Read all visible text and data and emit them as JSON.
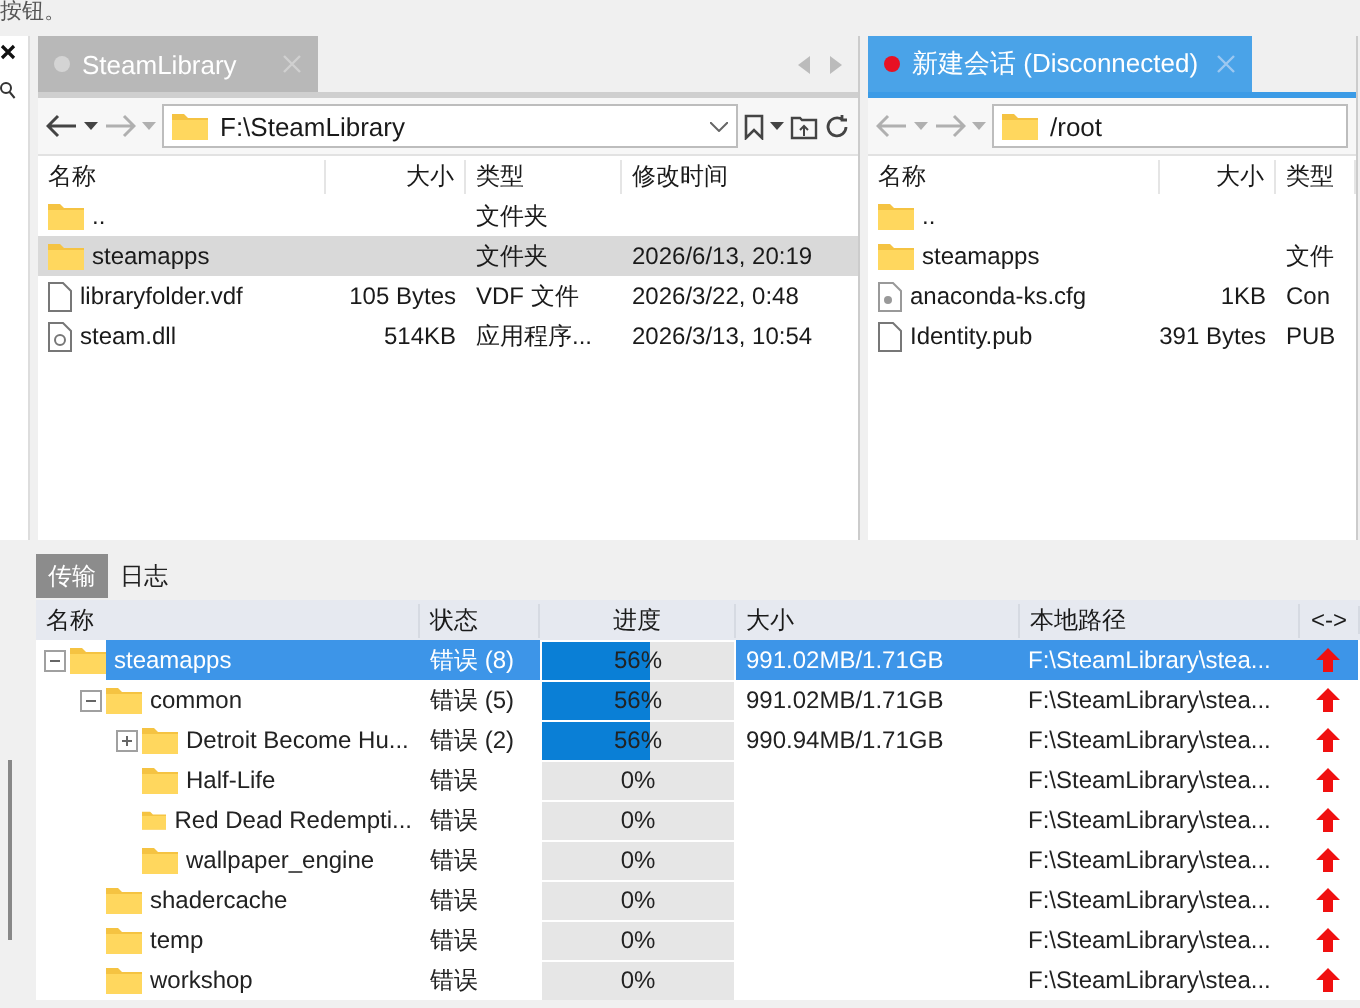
{
  "top_hint": "按钮。",
  "panels": [
    {
      "tab": {
        "title": "SteamLibrary",
        "active": false,
        "color": "#d4d4d4"
      },
      "tab_arrows": true,
      "back_enabled": true,
      "forward_enabled": false,
      "path": "F:\\SteamLibrary",
      "path_tools": true,
      "columns": [
        "名称",
        "大小",
        "类型",
        "修改时间"
      ],
      "rows": [
        {
          "kind": "folder",
          "selected": false,
          "cells": [
            "..",
            "",
            "文件夹",
            ""
          ]
        },
        {
          "kind": "folder",
          "selected": true,
          "cells": [
            "steamapps",
            "",
            "文件夹",
            "2026/6/13, 20:19"
          ]
        },
        {
          "kind": "file",
          "selected": false,
          "cells": [
            "libraryfolder.vdf",
            "105 Bytes",
            "VDF 文件",
            "2026/3/22, 0:48"
          ]
        },
        {
          "kind": "binary",
          "selected": false,
          "cells": [
            "steam.dll",
            "514KB",
            "应用程序...",
            "2026/3/13, 10:54"
          ]
        }
      ]
    },
    {
      "tab": {
        "title": "新建会话 (Disconnected)",
        "active": true,
        "color": "#e81123"
      },
      "tab_arrows": false,
      "back_enabled": false,
      "forward_enabled": false,
      "path": "/root",
      "path_tools": false,
      "columns": [
        "名称",
        "大小",
        "类型"
      ],
      "rows": [
        {
          "kind": "folder",
          "selected": false,
          "cells": [
            "..",
            "",
            ""
          ]
        },
        {
          "kind": "folder",
          "selected": false,
          "cells": [
            "steamapps",
            "",
            "文件"
          ]
        },
        {
          "kind": "config",
          "selected": false,
          "cells": [
            "anaconda-ks.cfg",
            "1KB",
            "Con"
          ]
        },
        {
          "kind": "file",
          "selected": false,
          "cells": [
            "Identity.pub",
            "391 Bytes",
            "PUB"
          ]
        }
      ]
    }
  ],
  "transfer": {
    "tabs": [
      {
        "label": "传输",
        "selected": true
      },
      {
        "label": "日志",
        "selected": false
      }
    ],
    "columns": [
      "名称",
      "状态",
      "进度",
      "大小",
      "本地路径",
      "<->"
    ],
    "rows": [
      {
        "name": "steamapps",
        "status": "错误 (8)",
        "level": 0.56,
        "progress": "56%",
        "size": "991.02MB/1.71GB",
        "path": "F:\\SteamLibrary\\stea...",
        "selected": true,
        "expanded": true,
        "children": [
          {
            "name": "common",
            "status": "错误 (5)",
            "level": 0.56,
            "progress": "56%",
            "size": "991.02MB/1.71GB",
            "path": "F:\\SteamLibrary\\stea...",
            "selected": false,
            "expanded": true,
            "children": [
              {
                "name": "Detroit Become Hu...",
                "status": "错误 (2)",
                "level": 0.56,
                "progress": "56%",
                "size": "990.94MB/1.71GB",
                "path": "F:\\SteamLibrary\\stea...",
                "selected": false,
                "expanded": false
              },
              {
                "name": "Half-Life",
                "status": "错误",
                "progress": "0%",
                "path": "F:\\SteamLibrary\\stea...",
                "selected": false
              },
              {
                "name": "Red Dead Redempti...",
                "status": "错误",
                "progress": "0%",
                "path": "F:\\SteamLibrary\\stea...",
                "selected": false
              },
              {
                "name": "wallpaper_engine",
                "status": "错误",
                "progress": "0%",
                "path": "F:\\SteamLibrary\\stea...",
                "selected": false
              }
            ]
          },
          {
            "name": "shadercache",
            "status": "错误",
            "progress": "0%",
            "path": "F:\\SteamLibrary\\stea...",
            "selected": false
          },
          {
            "name": "temp",
            "status": "错误",
            "progress": "0%",
            "path": "F:\\SteamLibrary\\stea...",
            "selected": false
          },
          {
            "name": "workshop",
            "status": "错误",
            "progress": "0%",
            "path": "F:\\SteamLibrary\\stea...",
            "selected": false
          }
        ]
      }
    ]
  }
}
